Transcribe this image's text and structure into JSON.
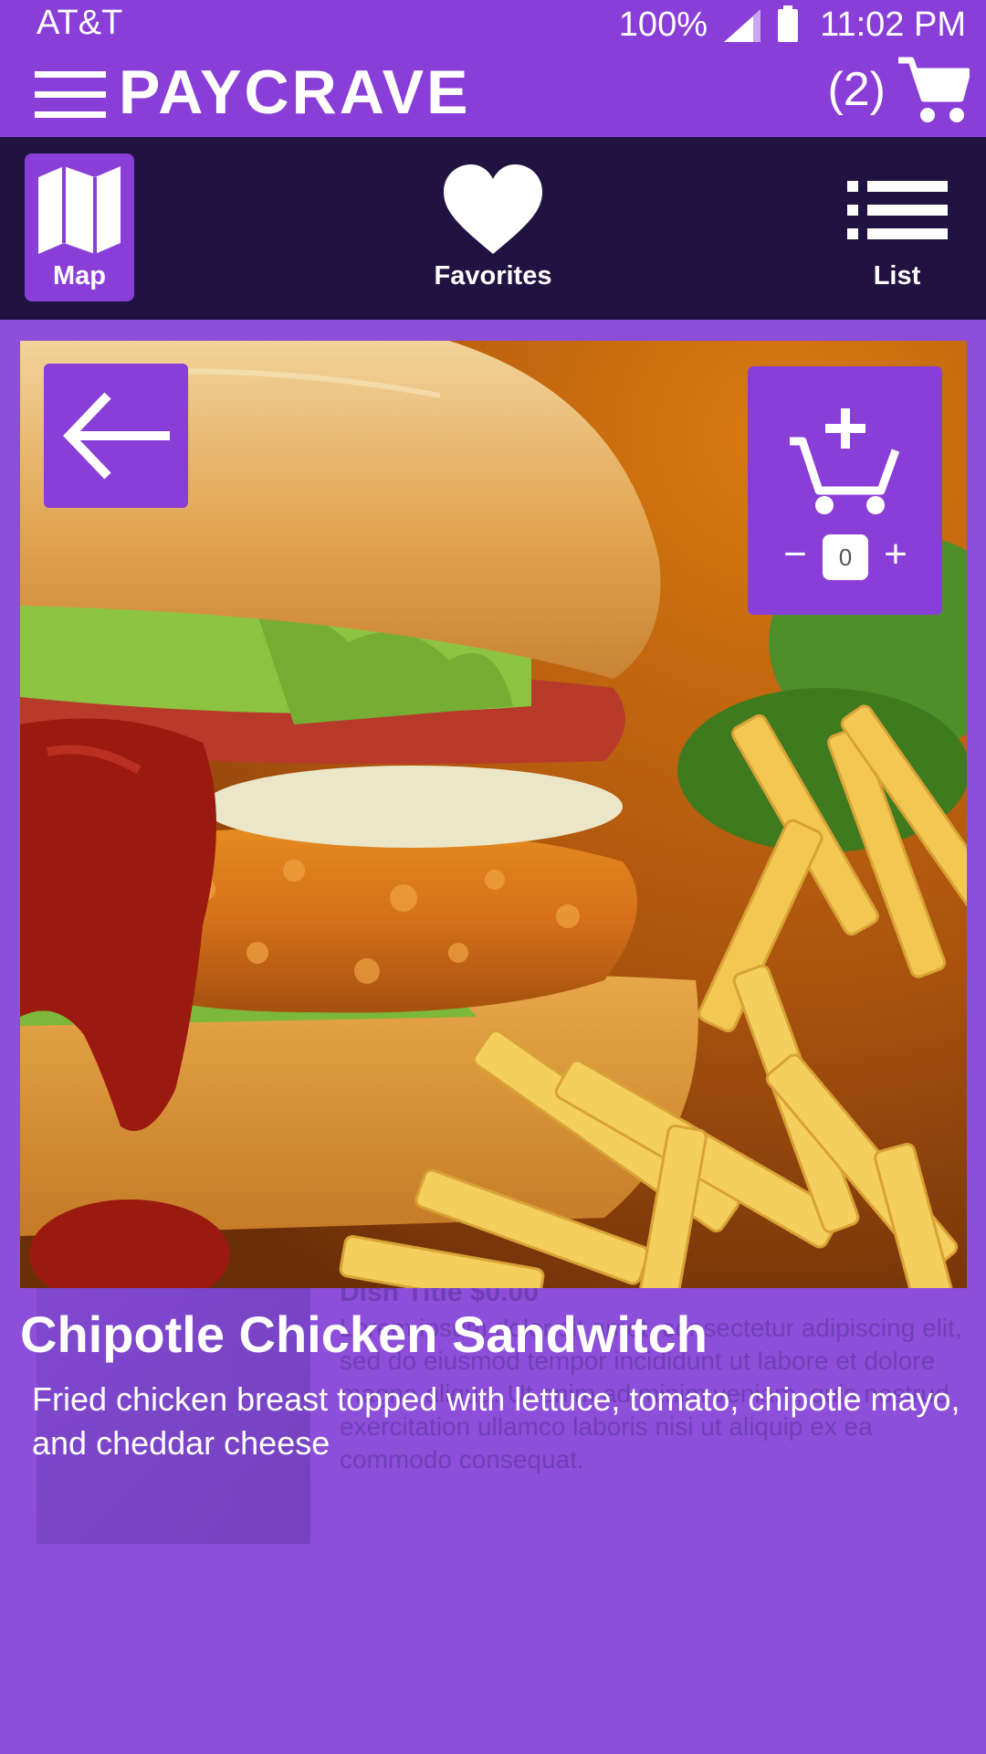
{
  "status_bar": {
    "carrier": "AT&T",
    "battery": "100%",
    "time": "11:02 PM",
    "icons": [
      "signal-icon",
      "battery-icon"
    ]
  },
  "app_bar": {
    "title": "PAYCRAVE",
    "cart_count": "(2)",
    "icons": [
      "menu-icon",
      "cart-icon"
    ]
  },
  "view_tabs": {
    "items": [
      {
        "label": "Map",
        "icon": "map-icon",
        "active": true
      },
      {
        "label": "Favorites",
        "icon": "heart-icon",
        "active": false
      },
      {
        "label": "List",
        "icon": "list-icon",
        "active": false
      }
    ]
  },
  "background_item": {
    "title": "Dish Title  $0.00",
    "description": "Lorem ipsum dolor sit amet, consectetur adipiscing elit, sed do eiusmod tempor incididunt ut labore et dolore magna aliqua. Ut enim ad minim veniam, quis nostrud exercitation ullamco laboris nisi ut aliquip ex ea commodo consequat."
  },
  "dish": {
    "name": "Chipotle Chicken Sandwitch",
    "description": "Fried chicken breast topped with lettuce, tomato, chipotle mayo, and cheddar cheese",
    "quantity": "0",
    "qty_minus": "−",
    "qty_plus": "+",
    "image": "chicken-sandwich-with-fries-photo"
  },
  "colors": {
    "primary": "#8a3ed8",
    "dark_bar": "#201341",
    "page_bg": "#8d4fd9"
  }
}
